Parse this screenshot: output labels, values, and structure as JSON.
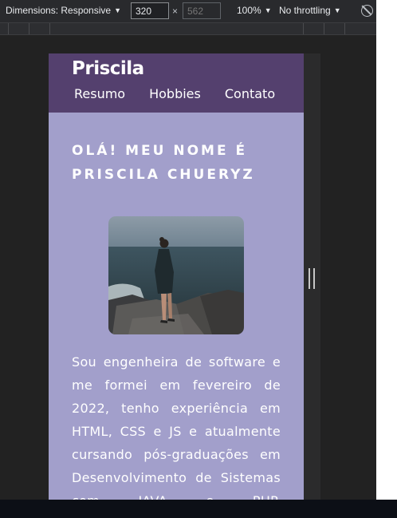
{
  "devtools": {
    "dimensions_label": "Dimensions: Responsive",
    "width_value": "320",
    "height_placeholder": "562",
    "times": "×",
    "zoom_label": "100%",
    "throttling_label": "No throttling",
    "caret": "▼"
  },
  "site": {
    "brand": "Priscila",
    "nav": [
      "Resumo",
      "Hobbies",
      "Contato"
    ],
    "hero_title": "OLÁ! MEU NOME É PRISCILA CHUERYZ",
    "bio": "Sou engenheira de software e me formei em fevereiro de 2022, tenho experiência em HTML, CSS e JS e atualmente cursando pós-graduações em Desenvolvimento de Sistemas com JAVA e PHP."
  },
  "colors": {
    "header_bg": "#54406e",
    "page_bg": "#a29fcb",
    "devtools_bg": "#292a2d"
  }
}
